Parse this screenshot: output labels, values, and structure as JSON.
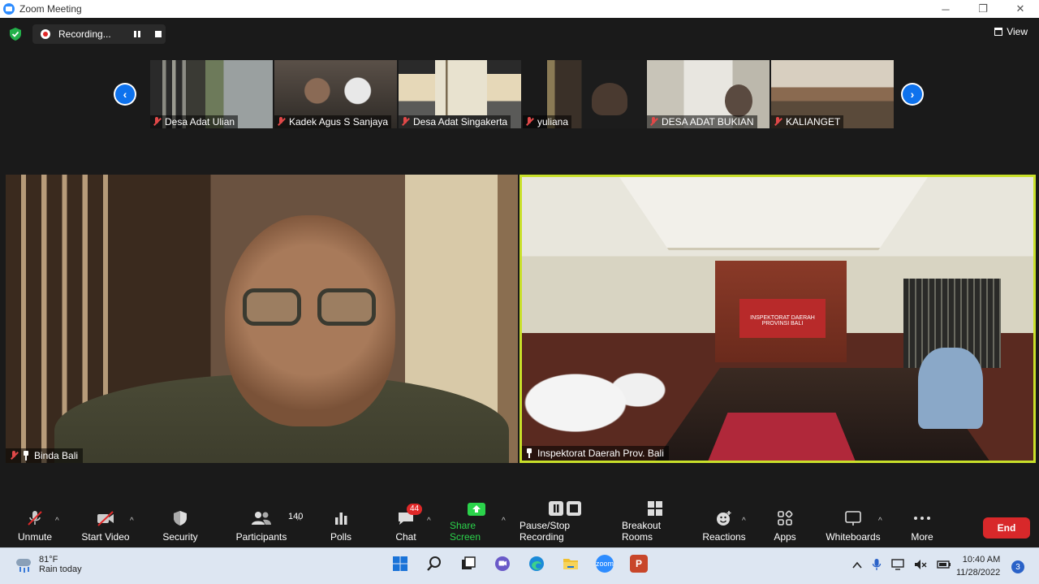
{
  "window": {
    "title": "Zoom Meeting",
    "minimize": "─",
    "restore": "❐",
    "close": "✕"
  },
  "recording": {
    "label": "Recording..."
  },
  "view": {
    "label": "View"
  },
  "gallery": {
    "prev": "‹",
    "next": "›",
    "tiles": [
      {
        "name": "Desa Adat Ulian"
      },
      {
        "name": "Kadek Agus S Sanjaya"
      },
      {
        "name": "Desa Adat Singakerta"
      },
      {
        "name": "yuliana"
      },
      {
        "name": "DESA ADAT BUKIAN"
      },
      {
        "name": "KALIANGET"
      }
    ]
  },
  "main_videos": {
    "left": {
      "name": "Binda Bali"
    },
    "right": {
      "name": "Inspektorat Daerah Prov. Bali",
      "banner": "INSPEKTORAT DAERAH PROVINSI BALI"
    }
  },
  "toolbar": {
    "unmute": "Unmute",
    "start_video": "Start Video",
    "security": "Security",
    "participants": "Participants",
    "participants_count": "140",
    "polls": "Polls",
    "chat": "Chat",
    "chat_badge": "44",
    "share_screen": "Share Screen",
    "pause_stop_recording": "Pause/Stop Recording",
    "breakout_rooms": "Breakout Rooms",
    "reactions": "Reactions",
    "apps": "Apps",
    "whiteboards": "Whiteboards",
    "more": "More",
    "end": "End"
  },
  "taskbar": {
    "weather_temp": "81°F",
    "weather_desc": "Rain today",
    "zoom_label": "zoom",
    "ppt_label": "P",
    "time": "10:40 AM",
    "date": "11/28/2022",
    "notifications": "3"
  },
  "colors": {
    "active_speaker_border": "#c9e02a",
    "end_button": "#d8282a",
    "share_green": "#2bd34b",
    "zoom_blue": "#0e72ed"
  }
}
